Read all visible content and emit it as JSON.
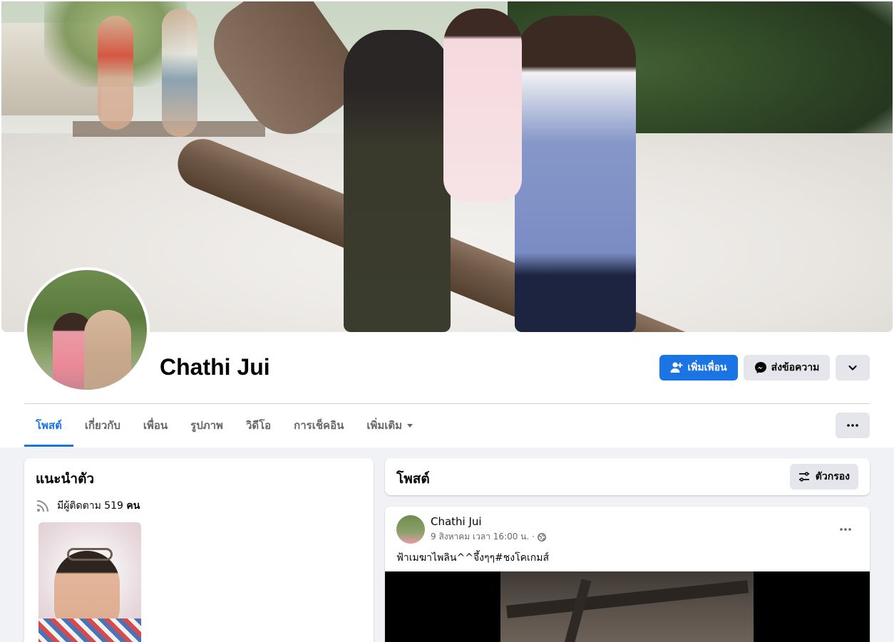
{
  "profile": {
    "name": "Chathi Jui",
    "add_friend_label": "เพิ่มเพื่อน",
    "message_label": "ส่งข้อความ"
  },
  "tabs": [
    {
      "label": "โพสต์",
      "active": true
    },
    {
      "label": "เกี่ยวกับ",
      "active": false
    },
    {
      "label": "เพื่อน",
      "active": false
    },
    {
      "label": "รูปภาพ",
      "active": false
    },
    {
      "label": "วิดีโอ",
      "active": false
    },
    {
      "label": "การเช็คอิน",
      "active": false
    },
    {
      "label": "เพิ่มเติม",
      "active": false
    }
  ],
  "intro": {
    "title": "แนะนำตัว",
    "followers_prefix": "มีผู้ติดตาม 519",
    "followers_unit": "คน"
  },
  "posts_section": {
    "title": "โพสต์",
    "filter_label": "ตัวกรอง"
  },
  "post": {
    "author": "Chathi Jui",
    "timestamp": "9 สิงหาคม เวลา 16:00 น. ·",
    "text": "ฟ้าเมฆาไพลิน^^จึ้งๆๆ#ชงโคเกมส์"
  },
  "colors": {
    "accent": "#1b74e4",
    "page_bg": "#f0f2f5",
    "button_gray": "#e4e6eb",
    "secondary_text": "#65676b"
  },
  "icons": {
    "add_friend": "person-plus-icon",
    "message": "messenger-icon",
    "more": "chevron-down-icon",
    "tab_more": "ellipsis-icon",
    "followers": "rss-icon",
    "filter": "sliders-icon",
    "privacy": "globe-icon"
  }
}
